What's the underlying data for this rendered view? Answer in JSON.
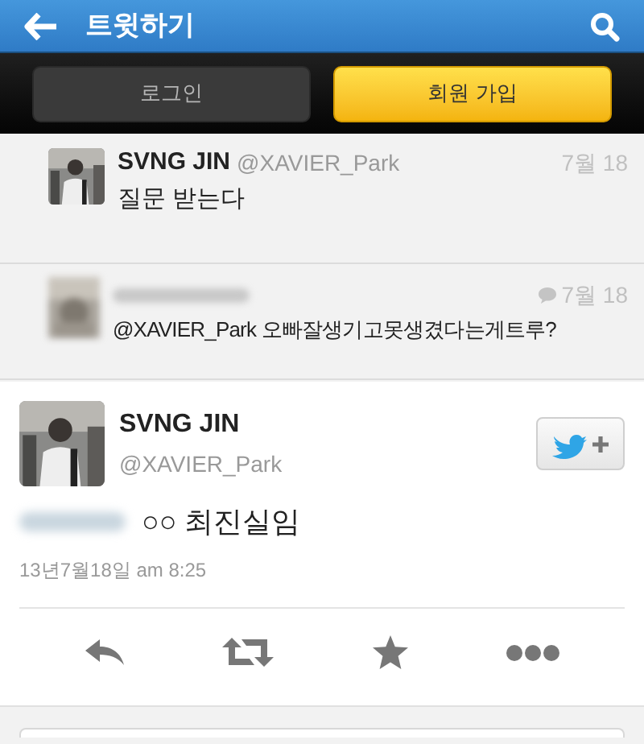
{
  "header": {
    "title": "트윗하기"
  },
  "buttons": [
    {
      "label": "로그인",
      "kind": "secondary"
    },
    {
      "label": "회원 가입",
      "kind": "primary"
    }
  ],
  "replies": [
    {
      "kind": "visible",
      "name": "SVNG JIN",
      "handle": "@XAVIER_Park",
      "date": "7월 18",
      "text": "질문 받는다"
    },
    {
      "kind": "blurred",
      "date": "7월 18",
      "text": "@XAVIER_Park 오빠잘생기고못생겼다는게트루?"
    }
  ],
  "tweet": {
    "name": "SVNG JIN",
    "handle": "@XAVIER_Park",
    "text": "○○ 최진실임",
    "time": "13년7월18일 am 8:25"
  }
}
